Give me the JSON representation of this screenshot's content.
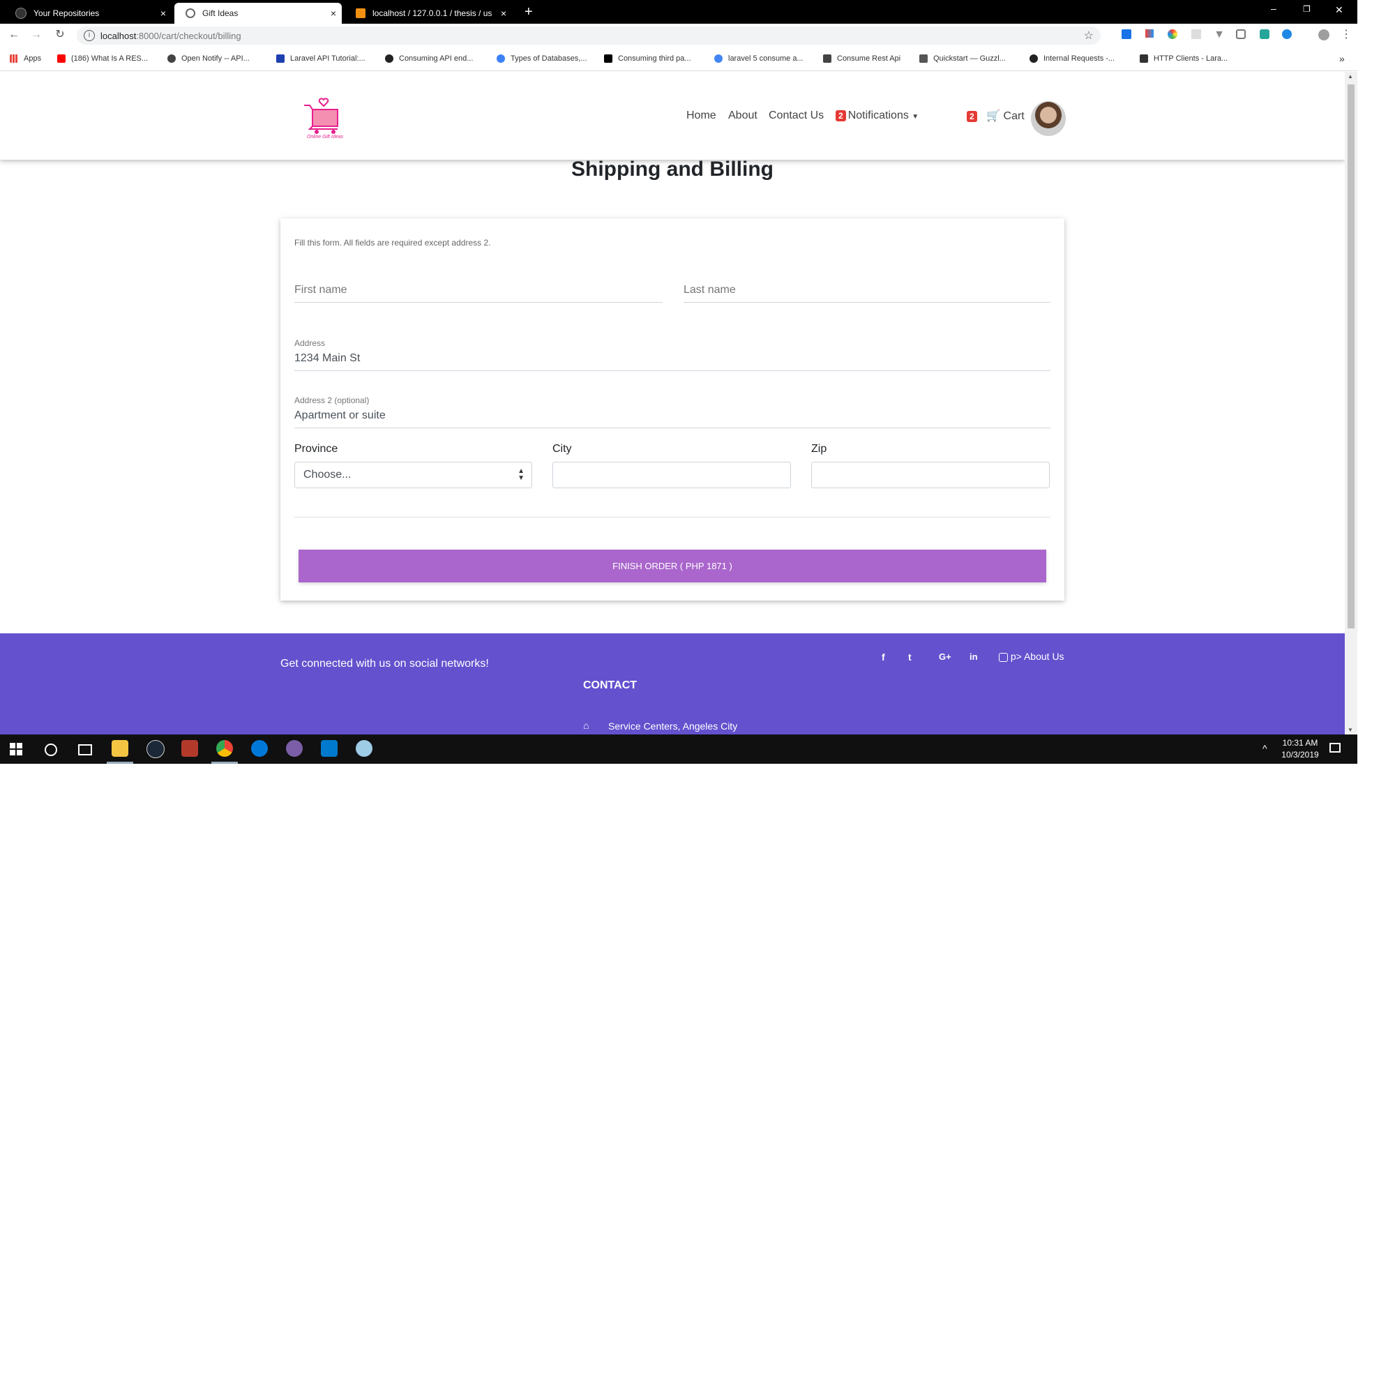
{
  "browser": {
    "tabs": [
      {
        "title": "Your Repositories",
        "close": "×"
      },
      {
        "title": "Gift Ideas",
        "close": "×"
      },
      {
        "title": "localhost / 127.0.0.1 / thesis / us",
        "close": "×"
      }
    ],
    "new_tab": "+",
    "window_controls": {
      "minimize": "–",
      "restore": "❐",
      "close": "✕"
    },
    "url_host": "localhost",
    "url_rest": ":8000/cart/checkout/billing",
    "bookmarks": [
      {
        "label": "Apps",
        "color": "#e8453c"
      },
      {
        "label": "(186) What Is A RES...",
        "color": "#ff0000"
      },
      {
        "label": "Open Notify -- API...",
        "color": "#444444"
      },
      {
        "label": "Laravel API Tutorial:...",
        "color": "#1e40af"
      },
      {
        "label": "Consuming API end...",
        "color": "#222222"
      },
      {
        "label": "Types of Databases,...",
        "color": "#3b82f6"
      },
      {
        "label": "Consuming third pa...",
        "color": "#000000"
      },
      {
        "label": "laravel 5 consume a...",
        "color": "#4285f4"
      },
      {
        "label": "Consume Rest Api",
        "color": "#444444"
      },
      {
        "label": "Quickstart — Guzzl...",
        "color": "#555555"
      },
      {
        "label": "Internal Requests -...",
        "color": "#222222"
      },
      {
        "label": "HTTP Clients - Lara...",
        "color": "#333333"
      }
    ],
    "more_bookmarks": "»"
  },
  "nav": {
    "logo_text": "Online Gift Ideas",
    "links": [
      "Home",
      "About",
      "Contact Us"
    ],
    "notifications_badge": "2",
    "notifications_label": "Notifications",
    "cart_badge": "2",
    "cart_label": "Cart"
  },
  "page": {
    "title": "Shipping and Billing",
    "form": {
      "instructions": "Fill this form. All fields are required except address 2.",
      "first_name_placeholder": "First name",
      "last_name_placeholder": "Last name",
      "address_label": "Address",
      "address_value": "1234 Main St",
      "address2_label": "Address 2 (optional)",
      "address2_value": "Apartment or suite",
      "province_label": "Province",
      "province_selected": "Choose...",
      "city_label": "City",
      "city_value": "",
      "zip_label": "Zip",
      "zip_value": "",
      "submit_label": "FINISH ORDER ( PHP 1871 )"
    }
  },
  "footer": {
    "social_text": "Get connected with us on social networks!",
    "social_icons": [
      "f",
      "t",
      "G+",
      "in"
    ],
    "about_link": "p> About Us",
    "contact_heading": "CONTACT",
    "address": "Service Centers, Angeles City"
  },
  "taskbar": {
    "time": "10:31 AM",
    "date": "10/3/2019"
  },
  "colors": {
    "accent_button": "#aa66cc",
    "footer_bg": "#6351ce",
    "badge": "#e53935"
  }
}
